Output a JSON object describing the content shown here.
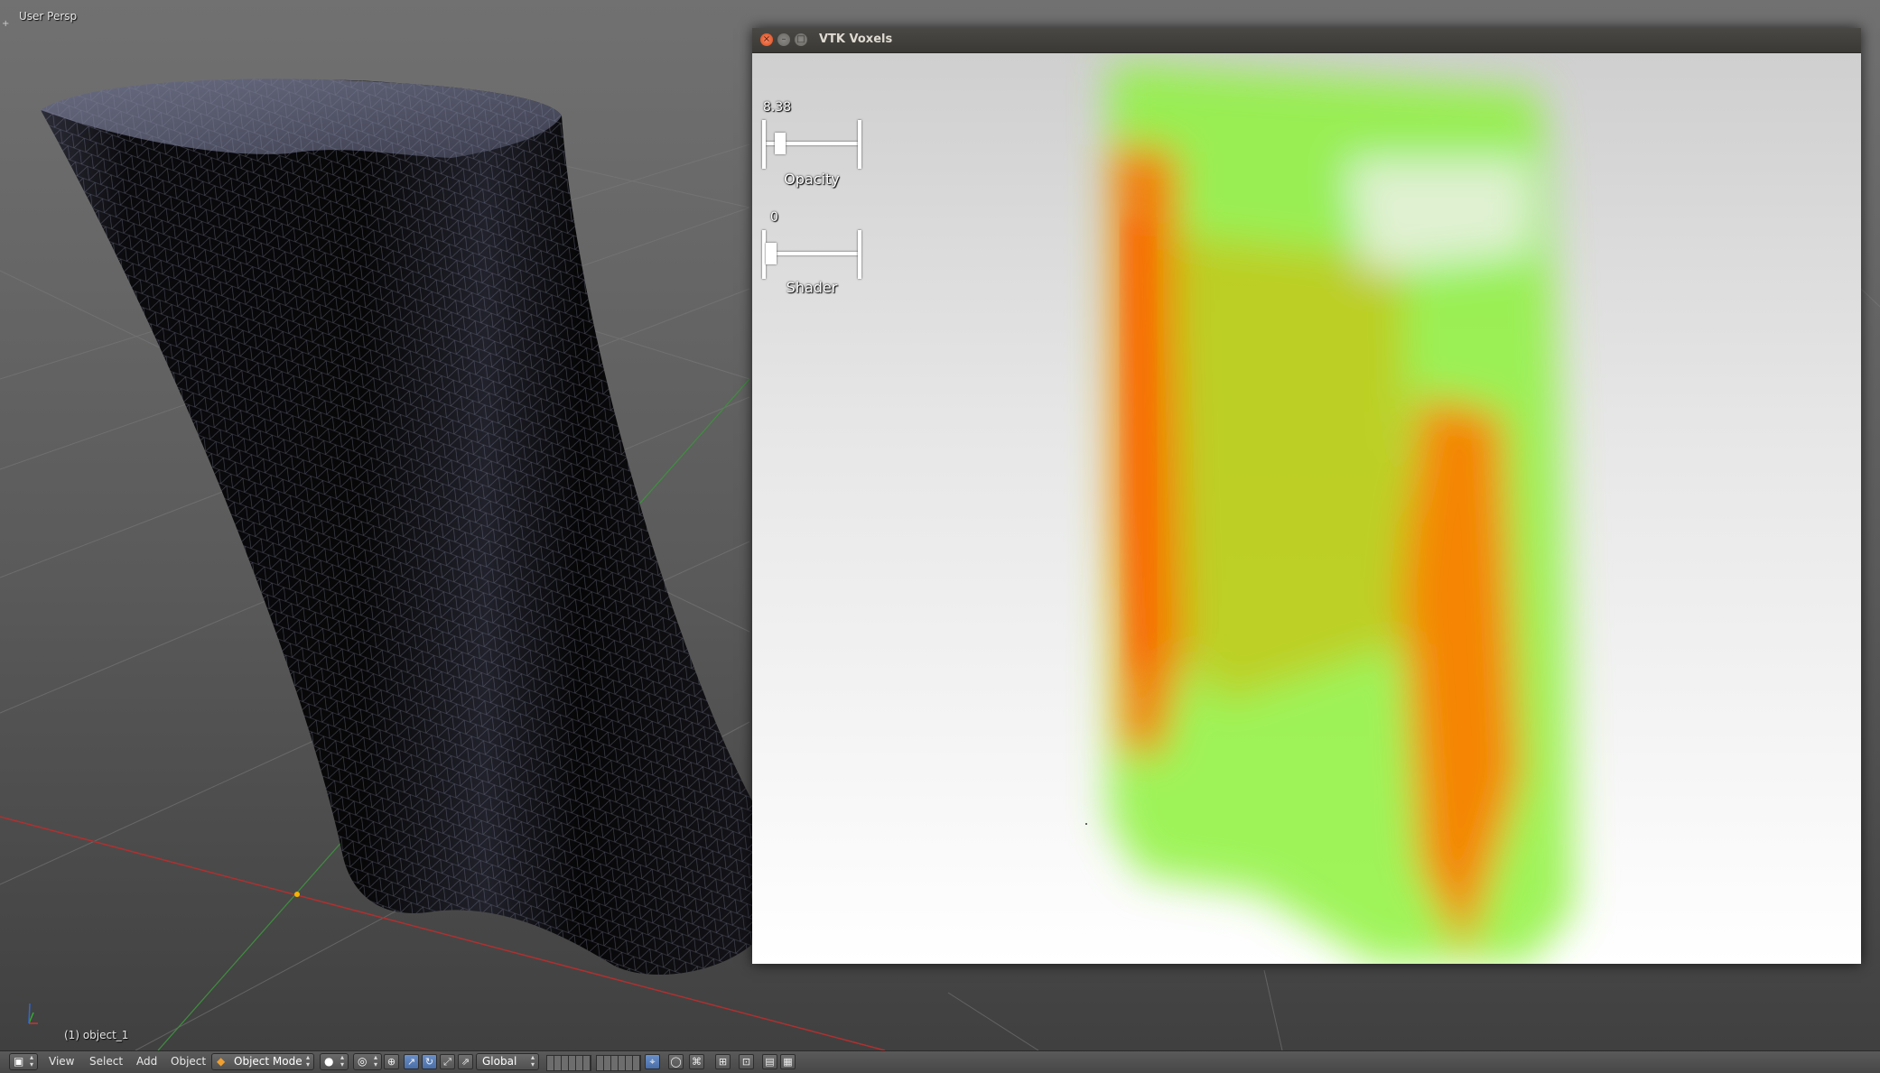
{
  "viewport": {
    "title": "User Persp",
    "object_label": "(1) object_1",
    "toggle_icon": "+"
  },
  "vtk_window": {
    "title": "VTK Voxels",
    "close_glyph": "×",
    "minimize_glyph": "–",
    "maximize_glyph": "□",
    "sliders": [
      {
        "name": "opacity",
        "value": "8.38",
        "title": "Opacity",
        "level": 0.1
      },
      {
        "name": "shader",
        "value": "0",
        "title": "Shader",
        "level": 0.0
      }
    ]
  },
  "header": {
    "editor_type_icon": "cube-view-icon",
    "menus": [
      "View",
      "Select",
      "Add",
      "Object"
    ],
    "mode": "Object Mode",
    "orientation": "Global",
    "icons": [
      "viewport-shading-icon",
      "pivot-icon",
      "manipulator-icon",
      "translate-icon",
      "rotate-icon",
      "scale-icon",
      "layers-icon",
      "lock-icon",
      "snap-icon",
      "proportional-icon",
      "render-icon",
      "camera-icon"
    ]
  }
}
